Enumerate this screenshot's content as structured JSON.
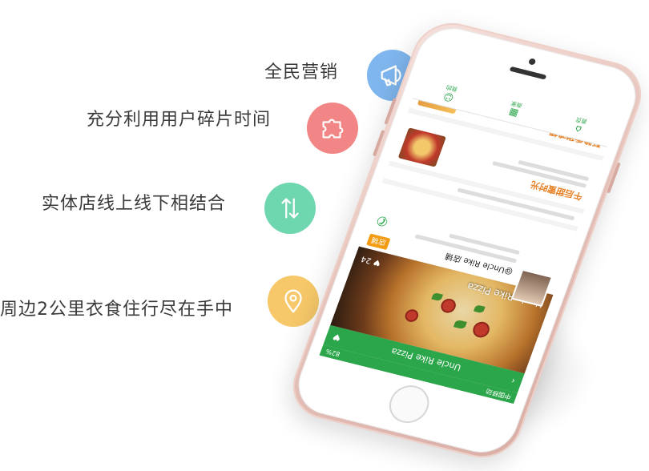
{
  "features": [
    {
      "text": "全民营销",
      "icon": "megaphone-icon",
      "color": "#7fb6ee"
    },
    {
      "text": "充分利用用户碎片时间",
      "icon": "puzzle-icon",
      "color": "#f28585"
    },
    {
      "text": "实体店线上线下相结合",
      "icon": "arrows-updown-icon",
      "color": "#6fd7b0"
    },
    {
      "text": "周边2公里衣食住行尽在手中",
      "icon": "location-pin-icon",
      "color": "#f6c869"
    }
  ],
  "phone": {
    "status_left": "中国移动",
    "status_right": "82%",
    "nav_title": "Uncle Rike Pizza",
    "hero_title": "Uncle Rike Pizza",
    "hero_likes": "24",
    "shop_name": "@Uncle Rike 店铺",
    "shop_tag": "店铺",
    "promo_1_title": "午后甜蜜时光",
    "promo_2_title": "酥脆香甜鸡翅",
    "tabs": [
      "首页",
      "商家",
      "我的"
    ],
    "accent": "#2ba64b"
  }
}
